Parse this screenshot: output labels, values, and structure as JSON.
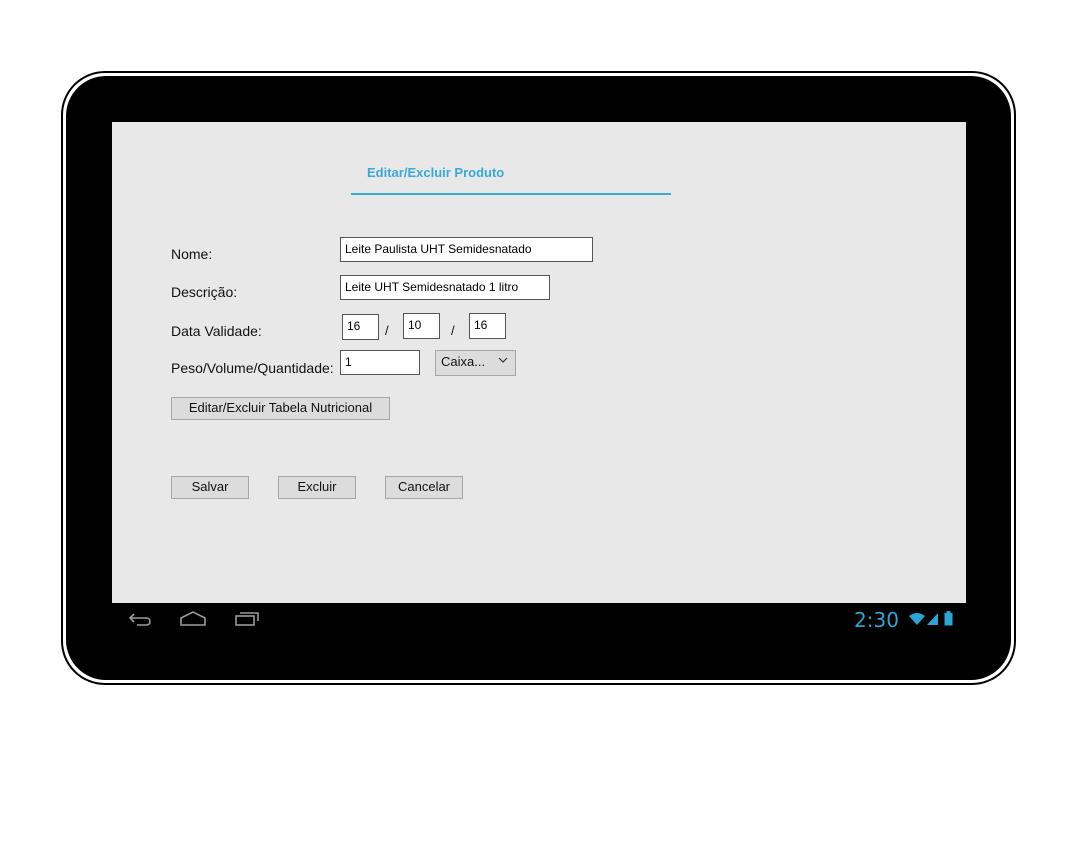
{
  "form": {
    "title": "Editar/Excluir Produto",
    "nome_label": "Nome:",
    "nome_value": "Leite Paulista UHT Semidesnatado",
    "descricao_label": "Descrição:",
    "descricao_value": "Leite UHT Semidesnatado 1 litro",
    "validade_label": "Data Validade:",
    "validade_day": "16",
    "validade_month": "10",
    "validade_year": "16",
    "date_separator": "/",
    "peso_label": "Peso/Volume/Quantidade:",
    "peso_value": "1",
    "unit_selected": "Caixa...",
    "tabela_button": "Editar/Excluir Tabela Nutricional",
    "salvar_button": "Salvar",
    "excluir_button": "Excluir",
    "cancelar_button": "Cancelar"
  },
  "status_bar": {
    "time": "2:30",
    "accent_color": "#2aa6d6"
  },
  "nav": {
    "icons": [
      "back-icon",
      "home-icon",
      "recent-apps-icon"
    ]
  },
  "colors": {
    "accent": "#39a9d8",
    "screen_background": "#e8e8e8"
  }
}
